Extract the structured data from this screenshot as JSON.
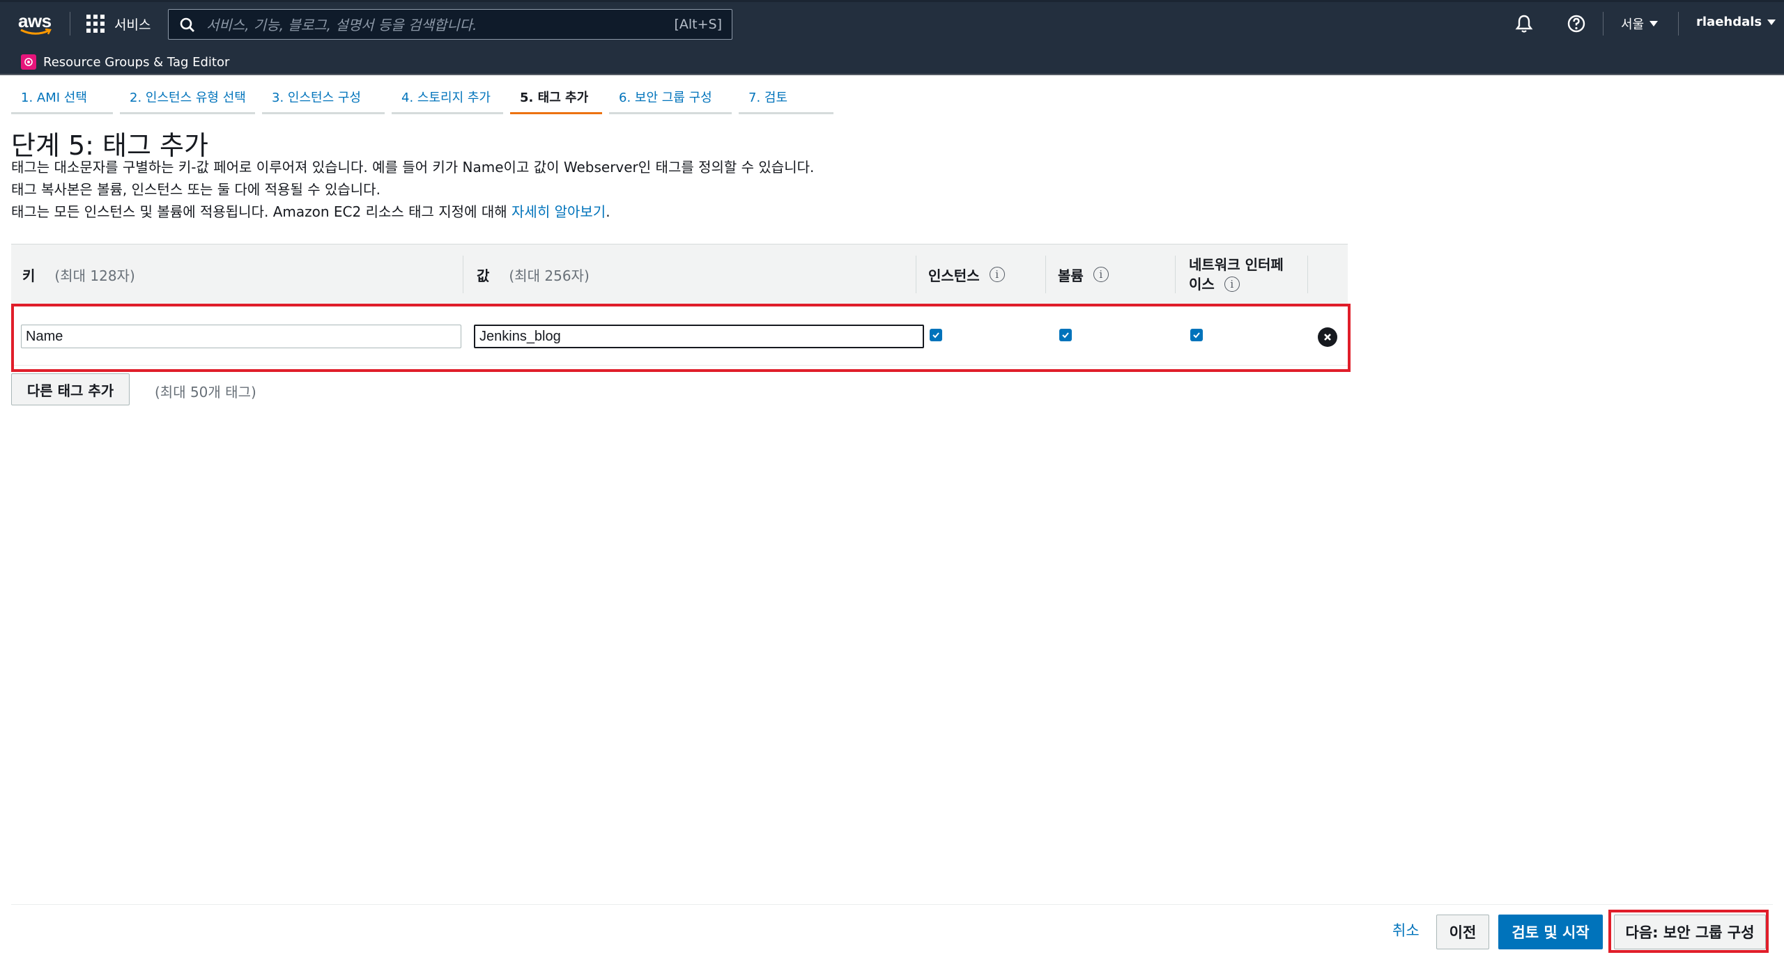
{
  "topnav": {
    "logo": "aws",
    "services_label": "서비스",
    "search_placeholder": "서비스, 기능, 블로그, 설명서 등을 검색합니다.",
    "search_shortcut": "[Alt+S]",
    "region": "서울",
    "user": "rlaehdals",
    "favorite": "Resource Groups & Tag Editor",
    "icons": [
      "grid-icon",
      "search-icon",
      "bell-icon",
      "help-icon",
      "caret-down-icon"
    ]
  },
  "steps": [
    {
      "label": "1. AMI 선택",
      "active": false
    },
    {
      "label": "2. 인스턴스 유형 선택",
      "active": false
    },
    {
      "label": "3. 인스턴스 구성",
      "active": false
    },
    {
      "label": "4. 스토리지 추가",
      "active": false
    },
    {
      "label": "5. 태그 추가",
      "active": true
    },
    {
      "label": "6. 보안 그룹 구성",
      "active": false
    },
    {
      "label": "7. 검토",
      "active": false
    }
  ],
  "page": {
    "title": "단계 5: 태그 추가",
    "desc1": "태그는 대소문자를 구별하는 키-값 페어로 이루어져 있습니다. 예를 들어 키가 Name이고 값이 Webserver인 태그를 정의할 수 있습니다.",
    "desc2": "태그 복사본은 볼륨, 인스턴스 또는 둘 다에 적용될 수 있습니다.",
    "desc3": "태그는 모든 인스턴스 및 볼륨에 적용됩니다. Amazon EC2 리소스 태그 지정에 대해 ",
    "desc3_link": "자세히 알아보기",
    "desc3_end": "."
  },
  "table": {
    "key_header": "키",
    "key_hint": "(최대 128자)",
    "value_header": "값",
    "value_hint": "(최대 256자)",
    "instances_header": "인스턴스",
    "volumes_header": "볼륨",
    "eni_header_line1": "네트워크 인터페",
    "eni_header_line2": "이스",
    "rows": [
      {
        "key": "Name",
        "value": "Jenkins_blog",
        "instances": true,
        "volumes": true,
        "network_interfaces": true
      }
    ]
  },
  "add_tag": {
    "label": "다른 태그 추가",
    "hint": "(최대 50개 태그)"
  },
  "footer": {
    "cancel": "취소",
    "previous": "이전",
    "review_launch": "검토 및 시작",
    "next": "다음: 보안 그룹 구성"
  },
  "colors": {
    "nav_bg": "#232f3e",
    "link": "#0073bb",
    "active_step": "#ec7211",
    "highlight": "#e01e2a"
  }
}
